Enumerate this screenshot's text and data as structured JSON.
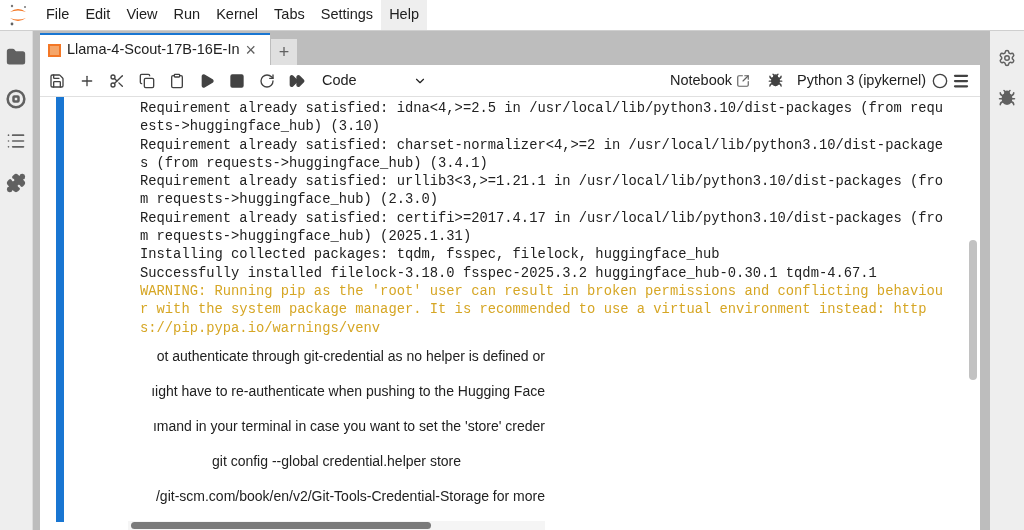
{
  "menu": [
    {
      "label": "File",
      "selected": false
    },
    {
      "label": "Edit",
      "selected": false
    },
    {
      "label": "View",
      "selected": false
    },
    {
      "label": "Run",
      "selected": false
    },
    {
      "label": "Kernel",
      "selected": false
    },
    {
      "label": "Tabs",
      "selected": false
    },
    {
      "label": "Settings",
      "selected": false
    },
    {
      "label": "Help",
      "selected": true
    }
  ],
  "tab": {
    "title": "Llama-4-Scout-17B-16E-In",
    "close": "×",
    "add": "+"
  },
  "toolbar": {
    "cell_type": "Code",
    "notebook": "Notebook",
    "kernel": "Python 3 (ipykernel)"
  },
  "output": [
    {
      "kind": "normal",
      "text": "Requirement already satisfied: idna<4,>=2.5 in /usr/local/lib/python3.10/dist-packages (from requ"
    },
    {
      "kind": "normal",
      "text": "ests->huggingface_hub) (3.10)"
    },
    {
      "kind": "normal",
      "text": "Requirement already satisfied: charset-normalizer<4,>=2 in /usr/local/lib/python3.10/dist-package"
    },
    {
      "kind": "normal",
      "text": "s (from requests->huggingface_hub) (3.4.1)"
    },
    {
      "kind": "normal",
      "text": "Requirement already satisfied: urllib3<3,>=1.21.1 in /usr/local/lib/python3.10/dist-packages (fro"
    },
    {
      "kind": "normal",
      "text": "m requests->huggingface_hub) (2.3.0)"
    },
    {
      "kind": "normal",
      "text": "Requirement already satisfied: certifi>=2017.4.17 in /usr/local/lib/python3.10/dist-packages (fro"
    },
    {
      "kind": "normal",
      "text": "m requests->huggingface_hub) (2025.1.31)"
    },
    {
      "kind": "normal",
      "text": "Installing collected packages: tqdm, fsspec, filelock, huggingface_hub"
    },
    {
      "kind": "normal",
      "text": "Successfully installed filelock-3.18.0 fsspec-2025.3.2 huggingface_hub-0.30.1 tqdm-4.67.1"
    },
    {
      "kind": "warning",
      "text": "WARNING: Running pip as the 'root' user can result in broken permissions and conflicting behaviou"
    },
    {
      "kind": "warning",
      "text": "r with the system package manager. It is recommended to use a virtual environment instead: http"
    },
    {
      "kind": "warning",
      "text": "s://pip.pypa.io/warnings/venv"
    }
  ],
  "html_output": [
    {
      "kind": "text",
      "text": "ot authenticate through git-credential as no helper is defined or"
    },
    {
      "kind": "text",
      "text": "ıight have to re-authenticate when pushing to the Hugging Face"
    },
    {
      "kind": "text",
      "text": "ımand in your terminal in case you want to set the 'store' creder"
    },
    {
      "kind": "command",
      "text": "git config --global credential.helper store"
    },
    {
      "kind": "text",
      "text": "/git-scm.com/book/en/v2/Git-Tools-Credential-Storage for more"
    }
  ]
}
